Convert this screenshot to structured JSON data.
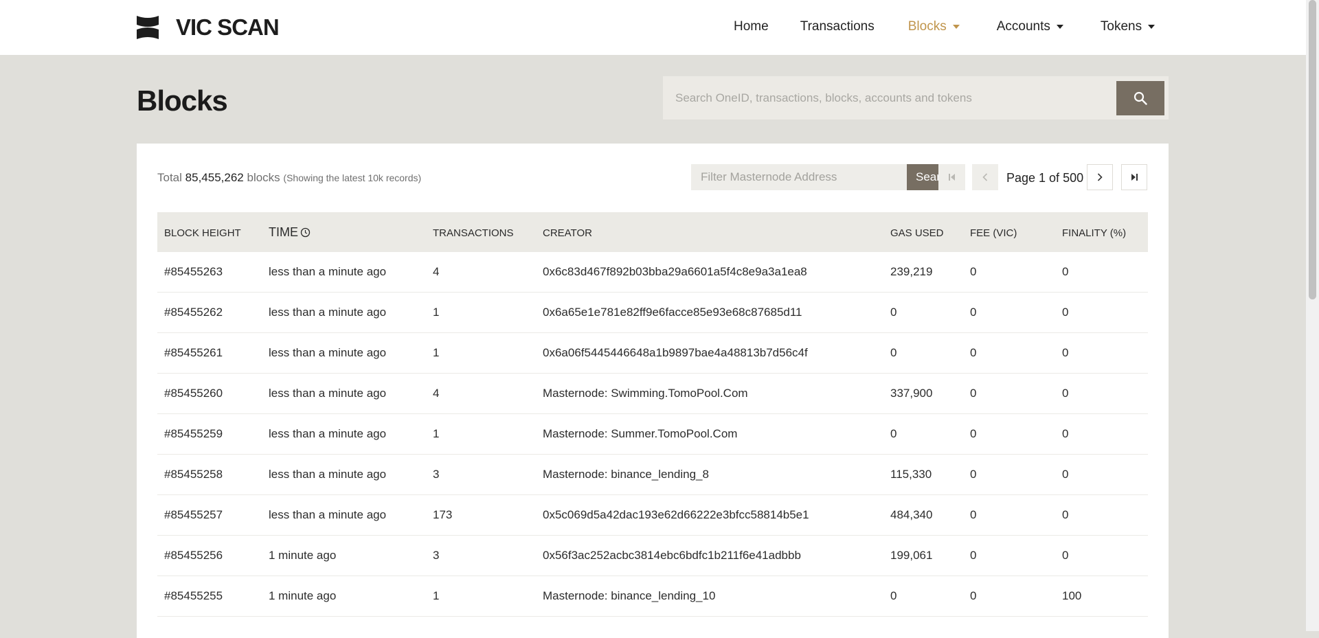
{
  "brand": {
    "name": "VIC SCAN"
  },
  "nav": {
    "items": [
      {
        "label": "Home"
      },
      {
        "label": "Transactions"
      },
      {
        "label": "Blocks"
      },
      {
        "label": "Accounts"
      },
      {
        "label": "Tokens"
      }
    ],
    "active": "Blocks",
    "active_color": "#c0954c"
  },
  "page": {
    "title": "Blocks"
  },
  "search": {
    "placeholder": "Search OneID, transactions, blocks, accounts and tokens",
    "icon": "search-icon"
  },
  "summary": {
    "prefix": "Total",
    "count": "85,455,262",
    "suffix": "blocks",
    "note": "(Showing the latest 10k records)"
  },
  "filter": {
    "placeholder": "Filter Masternode Address",
    "button_label": "Search"
  },
  "pagination": {
    "label": "Page 1 of 500",
    "current_page": 1,
    "total_pages": 500
  },
  "table": {
    "columns": [
      "BLOCK HEIGHT",
      "TIME",
      "TRANSACTIONS",
      "CREATOR",
      "GAS USED",
      "FEE (VIC)",
      "FINALITY (%)"
    ],
    "rows": [
      {
        "height": "#85455263",
        "time": "less than a minute ago",
        "txs": "4",
        "creator": "0x6c83d467f892b03bba29a6601a5f4c8e9a3a1ea8",
        "gas": "239,219",
        "fee": "0",
        "finality": "0"
      },
      {
        "height": "#85455262",
        "time": "less than a minute ago",
        "txs": "1",
        "creator": "0x6a65e1e781e82ff9e6facce85e93e68c87685d11",
        "gas": "0",
        "fee": "0",
        "finality": "0"
      },
      {
        "height": "#85455261",
        "time": "less than a minute ago",
        "txs": "1",
        "creator": "0x6a06f5445446648a1b9897bae4a48813b7d56c4f",
        "gas": "0",
        "fee": "0",
        "finality": "0"
      },
      {
        "height": "#85455260",
        "time": "less than a minute ago",
        "txs": "4",
        "creator": "Masternode: Swimming.TomoPool.Com",
        "gas": "337,900",
        "fee": "0",
        "finality": "0"
      },
      {
        "height": "#85455259",
        "time": "less than a minute ago",
        "txs": "1",
        "creator": "Masternode: Summer.TomoPool.Com",
        "gas": "0",
        "fee": "0",
        "finality": "0"
      },
      {
        "height": "#85455258",
        "time": "less than a minute ago",
        "txs": "3",
        "creator": "Masternode: binance_lending_8",
        "gas": "115,330",
        "fee": "0",
        "finality": "0"
      },
      {
        "height": "#85455257",
        "time": "less than a minute ago",
        "txs": "173",
        "creator": "0x5c069d5a42dac193e62d66222e3bfcc58814b5e1",
        "gas": "484,340",
        "fee": "0",
        "finality": "0"
      },
      {
        "height": "#85455256",
        "time": "1 minute ago",
        "txs": "3",
        "creator": "0x56f3ac252acbc3814ebc6bdfc1b211f6e41adbbb",
        "gas": "199,061",
        "fee": "0",
        "finality": "0"
      },
      {
        "height": "#85455255",
        "time": "1 minute ago",
        "txs": "1",
        "creator": "Masternode: binance_lending_10",
        "gas": "0",
        "fee": "0",
        "finality": "100"
      }
    ]
  }
}
